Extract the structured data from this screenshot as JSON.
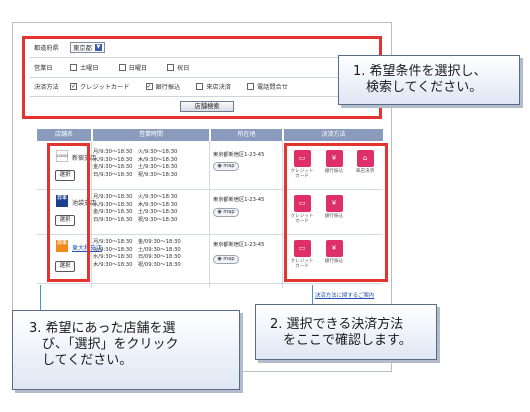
{
  "form": {
    "prefecture_label": "都道府県",
    "prefecture_value": "東京都",
    "days_label": "営業日",
    "days": [
      {
        "label": "土曜日",
        "checked": false
      },
      {
        "label": "日曜日",
        "checked": false
      },
      {
        "label": "祝日",
        "checked": false
      }
    ],
    "payment_label": "決済方法",
    "payments": [
      {
        "label": "クレジットカード",
        "checked": true
      },
      {
        "label": "銀行振込",
        "checked": true
      },
      {
        "label": "来店決済",
        "checked": false
      },
      {
        "label": "電話問合せ",
        "checked": false
      }
    ],
    "search_button": "店舗検索"
  },
  "table": {
    "headers": [
      "店舗名",
      "営業時間",
      "所在地",
      "決済方法"
    ],
    "rows": [
      {
        "logo": "LOGO",
        "name": "新宿支店",
        "select": "選択",
        "hours": "月/9:30〜18:30　火/9:30〜18:30\n水/9:30〜18:30　木/9:30〜18:30\n金/9:30〜18:30　土/9:30〜18:30\n日/9:30〜18:30　祝/9:30〜18:30",
        "address": "東京都新宿区1-23-45",
        "map": "map",
        "pay": [
          {
            "icon": "card-icon",
            "label": "クレジット\nカード"
          },
          {
            "icon": "bank-icon",
            "label": "銀行振込"
          },
          {
            "icon": "store-icon",
            "label": "来店決済"
          }
        ]
      },
      {
        "logo": "日本",
        "name": "池袋支店",
        "select": "選択",
        "hours": "月/9:30〜18:30　火/9:30〜18:30\n水/9:30〜18:30　木/9:30〜18:30\n金/9:30〜18:30　土/9:30〜18:30\n日/9:30〜18:30　祝/9:30〜18:30",
        "address": "東京都新宿区1-23-45",
        "map": "map",
        "pay": [
          {
            "icon": "card-icon",
            "label": "クレジット\nカード"
          },
          {
            "icon": "bank-icon",
            "label": "銀行振込"
          }
        ]
      },
      {
        "logo": "日本",
        "name": "東大和支店",
        "select": "選択",
        "hours": "月/9:30〜18:30　金/09:30〜18:30\n火/9:30〜18:30　土/09:30〜18:30\n水/9:30〜18:30　日/09:30〜18:30\n木/9:30〜18:30　祝/09:30〜18:30",
        "address": "東京都新宿区1-23-45",
        "map": "map",
        "pay": [
          {
            "icon": "card-icon",
            "label": "クレジット\nカード"
          },
          {
            "icon": "bank-icon",
            "label": "銀行振込"
          }
        ]
      }
    ],
    "link": "決済方法に関するご案内"
  },
  "callouts": {
    "c1": "1. 希望条件を選択し、\n　検索してください。",
    "c2": "2. 選択できる決済方法\n　をここで確認します。",
    "c3": "3. 希望にあった店舗を選\n　び、「選択」をクリック\n　してください。"
  },
  "colors": {
    "highlight": "#e3342f",
    "header": "#8a9bbd",
    "icon": "#de2f68"
  }
}
